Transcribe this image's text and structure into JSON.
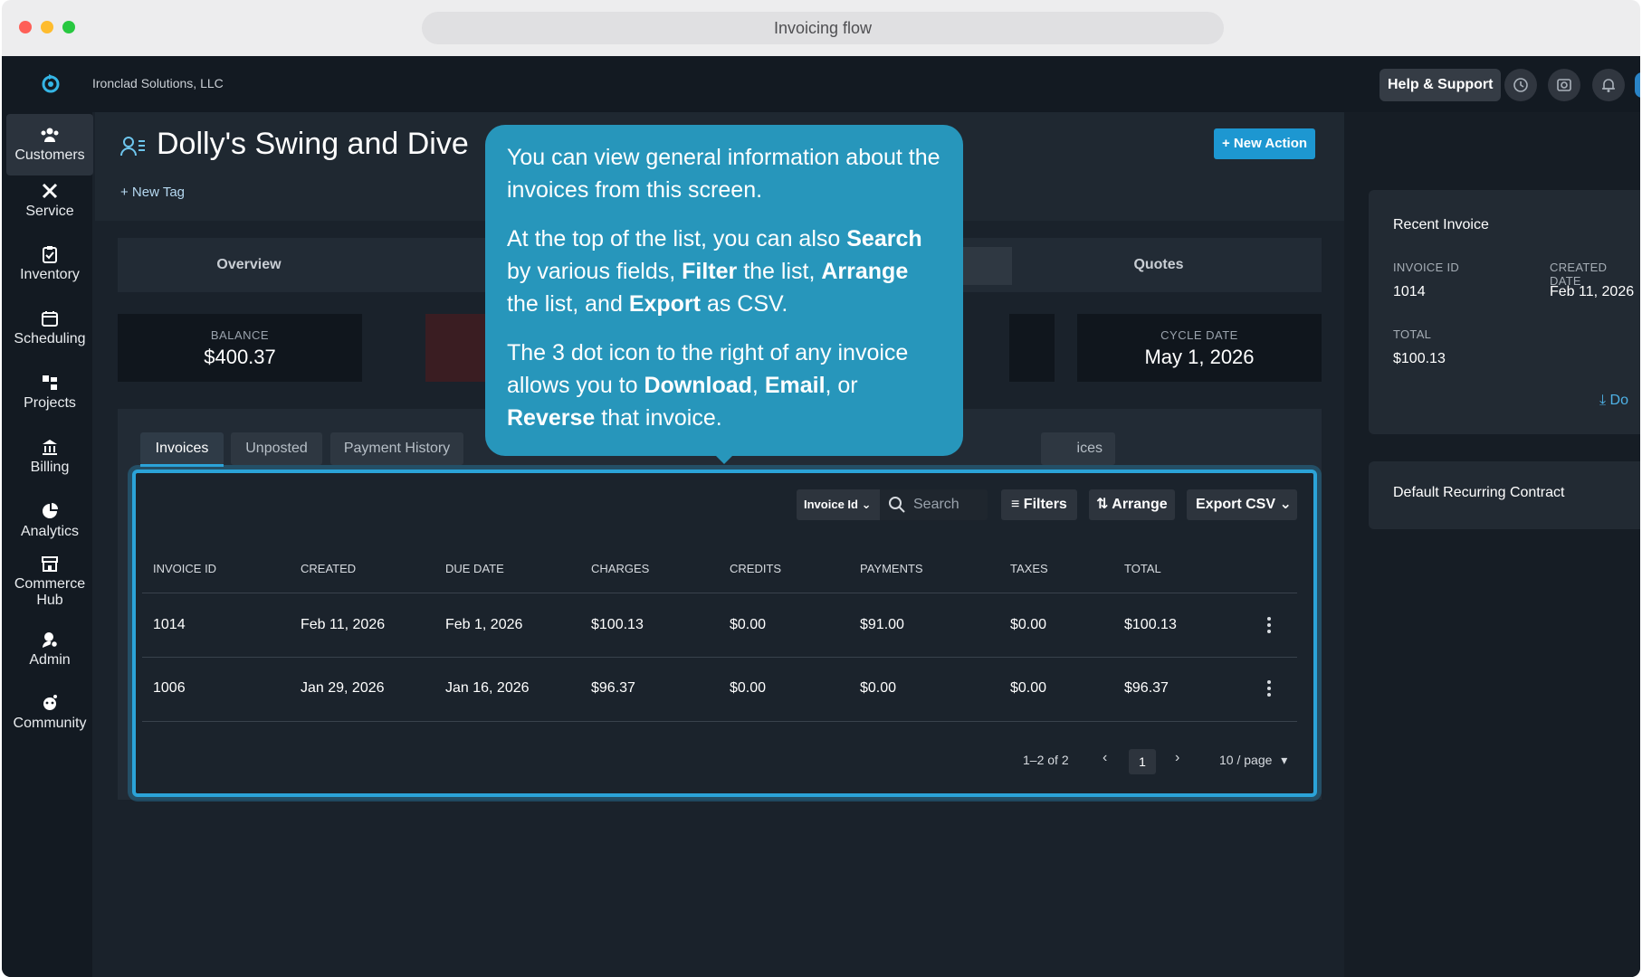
{
  "browser": {
    "url_title": "Invoicing flow"
  },
  "topbar": {
    "company": "Ironclad Solutions, LLC",
    "help_label": "Help & Support",
    "icons": [
      "history-icon",
      "camera-icon",
      "bell-icon"
    ]
  },
  "sidebar": {
    "items": [
      {
        "label": "Customers",
        "icon": "customers-icon",
        "active": true
      },
      {
        "label": "Service",
        "icon": "service-icon"
      },
      {
        "label": "Inventory",
        "icon": "inventory-icon"
      },
      {
        "label": "Scheduling",
        "icon": "calendar-icon"
      },
      {
        "label": "Projects",
        "icon": "projects-icon"
      },
      {
        "label": "Billing",
        "icon": "bank-icon"
      },
      {
        "label": "Analytics",
        "icon": "pie-chart-icon"
      },
      {
        "label": "Commerce Hub",
        "icon": "store-icon"
      },
      {
        "label": "Admin",
        "icon": "admin-icon"
      },
      {
        "label": "Community",
        "icon": "community-icon"
      }
    ]
  },
  "header": {
    "title": "Dolly's Swing and Dive",
    "new_tag": "+ New Tag",
    "new_action": "+ New Action"
  },
  "tabs": {
    "overview": "Overview",
    "quotes": "Quotes"
  },
  "stats": {
    "balance_label": "BALANCE",
    "balance_value": "$400.37",
    "cycle_label": "CYCLE DATE",
    "cycle_value": "May 1, 2026"
  },
  "subtabs": {
    "invoices": "Invoices",
    "unposted": "Unposted",
    "payment_history": "Payment History",
    "partial": "ices"
  },
  "toolbar": {
    "select_value": "Invoice Id",
    "search_placeholder": "Search",
    "filters": "Filters",
    "arrange": "Arrange",
    "export": "Export CSV"
  },
  "table": {
    "headers": [
      "INVOICE ID",
      "CREATED",
      "DUE DATE",
      "CHARGES",
      "CREDITS",
      "PAYMENTS",
      "TAXES",
      "TOTAL"
    ],
    "rows": [
      [
        "1014",
        "Feb 11, 2026",
        "Feb 1, 2026",
        "$100.13",
        "$0.00",
        "$91.00",
        "$0.00",
        "$100.13"
      ],
      [
        "1006",
        "Jan 29, 2026",
        "Jan 16, 2026",
        "$96.37",
        "$0.00",
        "$0.00",
        "$0.00",
        "$96.37"
      ]
    ]
  },
  "pager": {
    "range": "1–2 of 2",
    "page": "1",
    "per_page": "10 / page"
  },
  "recent_invoice": {
    "title": "Recent Invoice",
    "id_label": "INVOICE ID",
    "id_value": "1014",
    "created_label": "CREATED DATE",
    "created_value": "Feb 11, 2026",
    "total_label": "TOTAL",
    "total_value": "$100.13",
    "download_partial": "Do"
  },
  "contract": {
    "title": "Default Recurring Contract"
  },
  "tooltip": {
    "p1": "You can view general information about the invoices from this screen.",
    "p2_a": "At the top of the list, you can also ",
    "p2_search": "Search",
    "p2_b": " by various fields, ",
    "p2_filter": "Filter",
    "p2_c": " the list, ",
    "p2_arrange": "Arrange",
    "p2_d": " the list, and ",
    "p2_export": "Export",
    "p2_e": " as CSV.",
    "p3_a": "The 3 dot icon to the right of any invoice allows you to ",
    "p3_download": "Download",
    "p3_b": ", ",
    "p3_email": "Email",
    "p3_c": ", or ",
    "p3_reverse": "Reverse",
    "p3_d": " that invoice."
  },
  "colors": {
    "accent": "#2ba3d8",
    "tooltip": "#2796bb",
    "button": "#1d97d1"
  }
}
